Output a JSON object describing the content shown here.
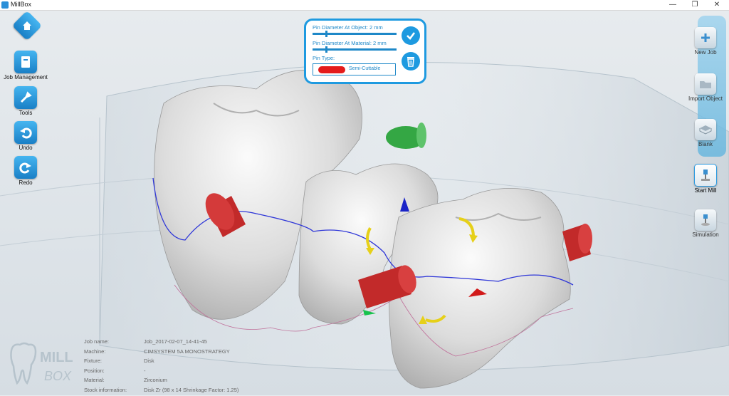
{
  "window": {
    "title": "MillBox",
    "minimize": "—",
    "maximize": "❐",
    "close": "✕"
  },
  "left_toolbar": [
    {
      "label": "",
      "icon": "home-icon"
    },
    {
      "label": "Job Management",
      "icon": "job-management-icon"
    },
    {
      "label": "Tools",
      "icon": "tools-icon"
    },
    {
      "label": "Undo",
      "icon": "undo-icon"
    },
    {
      "label": "Redo",
      "icon": "redo-icon"
    }
  ],
  "right_toolbar": [
    {
      "label": "New Job",
      "icon": "new-job-icon"
    },
    {
      "label": "Import Object",
      "icon": "import-object-icon"
    },
    {
      "label": "Blank",
      "icon": "blank-icon"
    },
    {
      "label": "Start Mill",
      "icon": "start-mill-icon",
      "active": true
    },
    {
      "label": "Simulation",
      "icon": "simulation-icon"
    }
  ],
  "pin_panel": {
    "diameter_object_label": "Pin Diameter At Object: 2 mm",
    "diameter_object_value": 0.15,
    "diameter_material_label": "Pin Diameter At Material: 2 mm",
    "diameter_material_value": 0.15,
    "pin_type_label": "Pin Type:",
    "pin_type_value": "Semi-Cuttable",
    "pin_type_color": "#e41b1b",
    "confirm_icon": "checkmark-icon",
    "delete_icon": "trash-icon",
    "accent": "#1e9ae0"
  },
  "job_info": [
    {
      "key": "Job name:",
      "value": "Job_2017-02-07_14-41-45"
    },
    {
      "key": "Machine:",
      "value": "CIMSYSTEM 5A MONOSTRATEGY"
    },
    {
      "key": "Fixture:",
      "value": "Disk"
    },
    {
      "key": "Position:",
      "value": "-"
    },
    {
      "key": "Material:",
      "value": "Zirconium"
    },
    {
      "key": "Stock information:",
      "value": "Disk Zr (98 x 14 Shrinkage Factor: 1.25)"
    }
  ],
  "brand": {
    "line1": "MILL",
    "line2": "BOX"
  }
}
